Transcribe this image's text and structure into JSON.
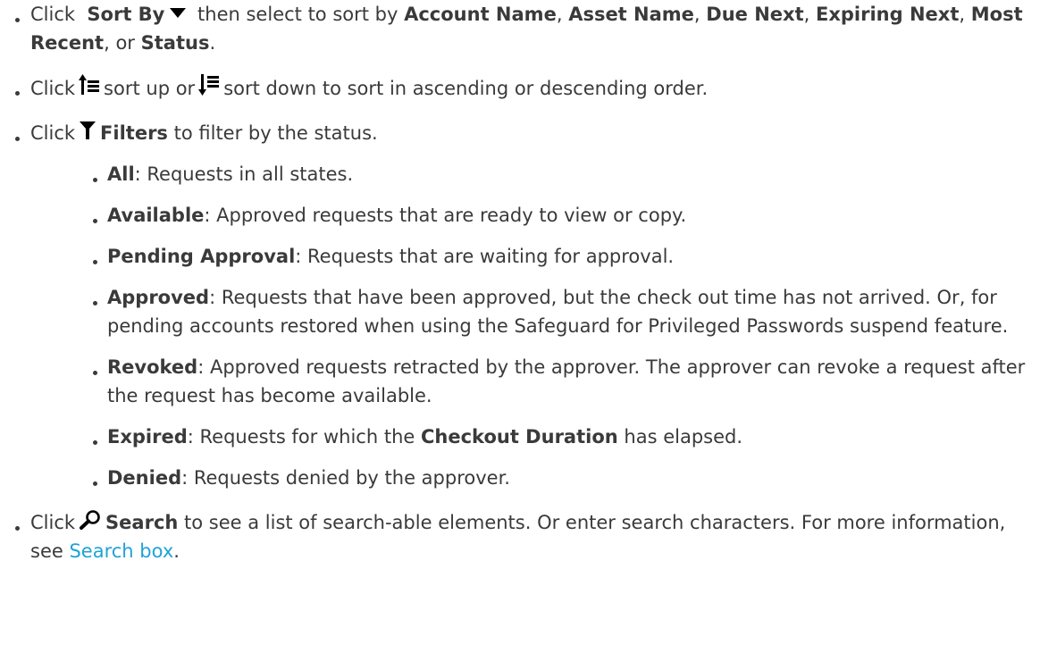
{
  "items": {
    "sort": {
      "click": "Click",
      "label": "Sort By",
      "icon": "sort-dropdown-triangle-icon",
      "text1": "then select to sort by",
      "opt1": "Account Name",
      "sep1": ",",
      "opt2": "Asset Name",
      "sep2": ",",
      "opt3": "Due Next",
      "sep3": ",",
      "opt4": "Expiring Next",
      "sep4": ",",
      "opt5": "Most Recent",
      "sep5": ", or",
      "opt6": "Status",
      "end": "."
    },
    "order": {
      "click": "Click",
      "icon_up": "sort-up-icon",
      "text1": "sort up or",
      "icon_down": "sort-down-icon",
      "text2": "sort down to sort in ascending or descending order."
    },
    "filters": {
      "click": "Click",
      "icon": "filter-funnel-icon",
      "label": "Filters",
      "text": "to filter by the status.",
      "statuses": [
        {
          "label": "All",
          "desc": ": Requests in all states."
        },
        {
          "label": "Available",
          "desc": ": Approved requests that are ready to view or copy."
        },
        {
          "label": "Pending Approval",
          "desc": ": Requests that are waiting for approval."
        },
        {
          "label": "Approved",
          "desc": ": Requests that have been approved, but the check out time has not arrived. Or, for pending accounts restored when using the Safeguard for Privileged Passwords suspend feature."
        },
        {
          "label": "Revoked",
          "desc": ": Approved requests retracted by the approver. The approver can revoke a request after the request has become available."
        },
        {
          "label": "Expired",
          "desc_a": ": Requests for which the",
          "bold": "Checkout Duration",
          "desc_b": "has elapsed."
        },
        {
          "label": "Denied",
          "desc": ": Requests denied by the approver."
        }
      ]
    },
    "search": {
      "click": "Click",
      "icon": "search-magnifier-icon",
      "label": "Search",
      "text": "to see a list of search-able elements. Or enter search characters. For more information, see",
      "link": "Search box",
      "end": "."
    }
  },
  "colors": {
    "text": "#3a3a3a",
    "link": "#1fa3d6"
  }
}
